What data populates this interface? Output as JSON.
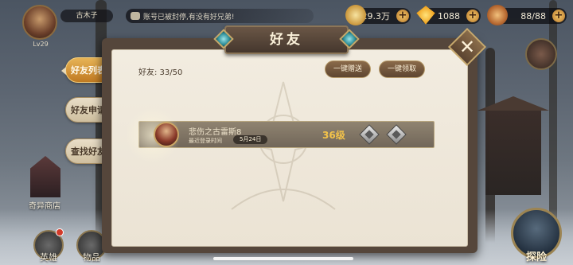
{
  "player": {
    "name": "古木子",
    "level": "Lv29"
  },
  "chat": {
    "message": "账号已被封停,有没有好兄弟!"
  },
  "resources": {
    "gold": "29.3万",
    "gems": "1088",
    "stamina": "88/88"
  },
  "panel": {
    "title": "好友",
    "friend_count_label": "好友: 33/50",
    "send_all_label": "一键赠送",
    "receive_all_label": "一键领取"
  },
  "tabs": [
    {
      "label": "好友列表",
      "active": true
    },
    {
      "label": "好友申请",
      "active": false
    },
    {
      "label": "查找好友",
      "active": false
    }
  ],
  "friends": [
    {
      "name": "悲伤之古雷斯8",
      "last_login_label": "最近登录时间",
      "last_login_date": "5月24日",
      "level": "36级"
    }
  ],
  "hud": {
    "shop_label": "奇异商店",
    "heroes_label": "英雄",
    "items_label": "物品",
    "explore_label": "探险"
  },
  "colors": {
    "active_tab": "#d89a3c",
    "level_text": "#f3c34a",
    "panel_bg": "#f0e9dc"
  }
}
